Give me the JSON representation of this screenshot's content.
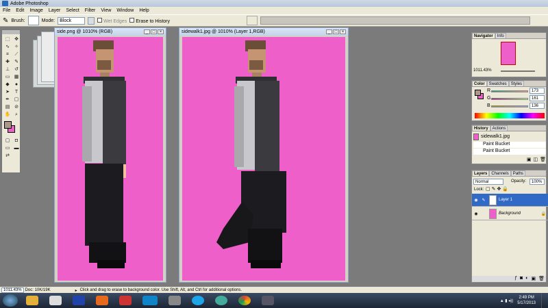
{
  "app_title": "Adobe Photoshop",
  "menu": [
    "File",
    "Edit",
    "Image",
    "Layer",
    "Select",
    "Filter",
    "View",
    "Window",
    "Help"
  ],
  "options": {
    "brush_label": "Brush:",
    "mode_label": "Mode:",
    "mode_value": "Block",
    "wet_edges": "Wet Edges",
    "erase_history": "Erase to History"
  },
  "doc1": {
    "title": "side.png @ 1010% (RGB)"
  },
  "doc2": {
    "title": "sidewalk1.jpg @ 1010% (Layer 1,RGB)"
  },
  "navigator": {
    "tabs": [
      "Navigator",
      "Info"
    ],
    "zoom": "1011.43%"
  },
  "color": {
    "tabs": [
      "Color",
      "Swatches",
      "Styles"
    ],
    "r_label": "R",
    "g_label": "G",
    "b_label": "B",
    "r": "173",
    "g": "161",
    "b": "136",
    "fg": "#ad9888",
    "bg": "#ed5fc8"
  },
  "history": {
    "tabs": [
      "History",
      "Actions"
    ],
    "snapshot": "sidewalk1.jpg",
    "items": [
      "Paint Bucket",
      "Paint Bucket"
    ]
  },
  "layers": {
    "tabs": [
      "Layers",
      "Channels",
      "Paths"
    ],
    "blend": "Normal",
    "opacity_label": "Opacity:",
    "opacity": "100%",
    "lock_label": "Lock:",
    "items": [
      "Layer 1",
      "Background"
    ]
  },
  "status": {
    "zoom": "1011.43%",
    "doc": "Doc: 10K/19K",
    "hint": "Click and drag to erase to background color.  Use Shift, Alt, and Ctrl for additional options."
  },
  "clock": {
    "time": "2:49 PM",
    "date": "5/17/2013"
  },
  "canvas_color": "#ee5fc9"
}
